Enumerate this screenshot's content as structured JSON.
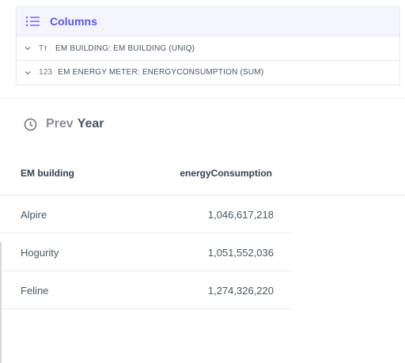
{
  "columns_panel": {
    "title": "Columns",
    "icon": "list-icon",
    "accent_color": "#5f55e6",
    "items": [
      {
        "type_icon": "Tт",
        "label": "EM BUILDING: EM BUILDING (UNIQ)"
      },
      {
        "type_icon": "123",
        "label": "EM ENERGY METER: ENERGYCONSUMPTION (SUM)"
      }
    ]
  },
  "period": {
    "icon": "clock-icon",
    "prefix": "Prev",
    "label": "Year"
  },
  "table": {
    "columns": [
      "EM building",
      "energyConsumption"
    ],
    "rows": [
      {
        "building": "Alpire",
        "energy": "1,046,617,218"
      },
      {
        "building": "Hogurity",
        "energy": "1,051,552,036"
      },
      {
        "building": "Feline",
        "energy": "1,274,326,220"
      }
    ]
  }
}
